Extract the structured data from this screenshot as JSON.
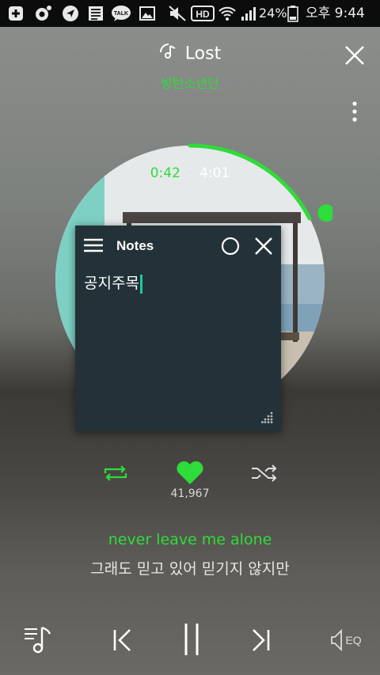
{
  "status_bar": {
    "battery": "24%",
    "time": "오후 9:44",
    "icons": [
      "plus-box-icon",
      "music-app-icon",
      "navigation-icon",
      "news-icon",
      "talk-icon",
      "image-icon",
      "mute-icon",
      "hd-icon",
      "wifi-icon",
      "signal-icon",
      "battery-icon"
    ]
  },
  "player": {
    "title": "Lost",
    "artist": "방탄소년단",
    "current_time": "0:42",
    "separator": "·",
    "total_time": "4:01",
    "progress": 0.174,
    "like_count": "41,967",
    "liked": true,
    "lyrics": [
      "never leave me alone",
      "그래도 믿고 있어 믿기지 않지만"
    ],
    "accent": "#2edc3a"
  },
  "notes_window": {
    "title": "Notes",
    "text": "공지주목",
    "background": "#233238"
  },
  "controls": {
    "eq_label": "EQ"
  }
}
